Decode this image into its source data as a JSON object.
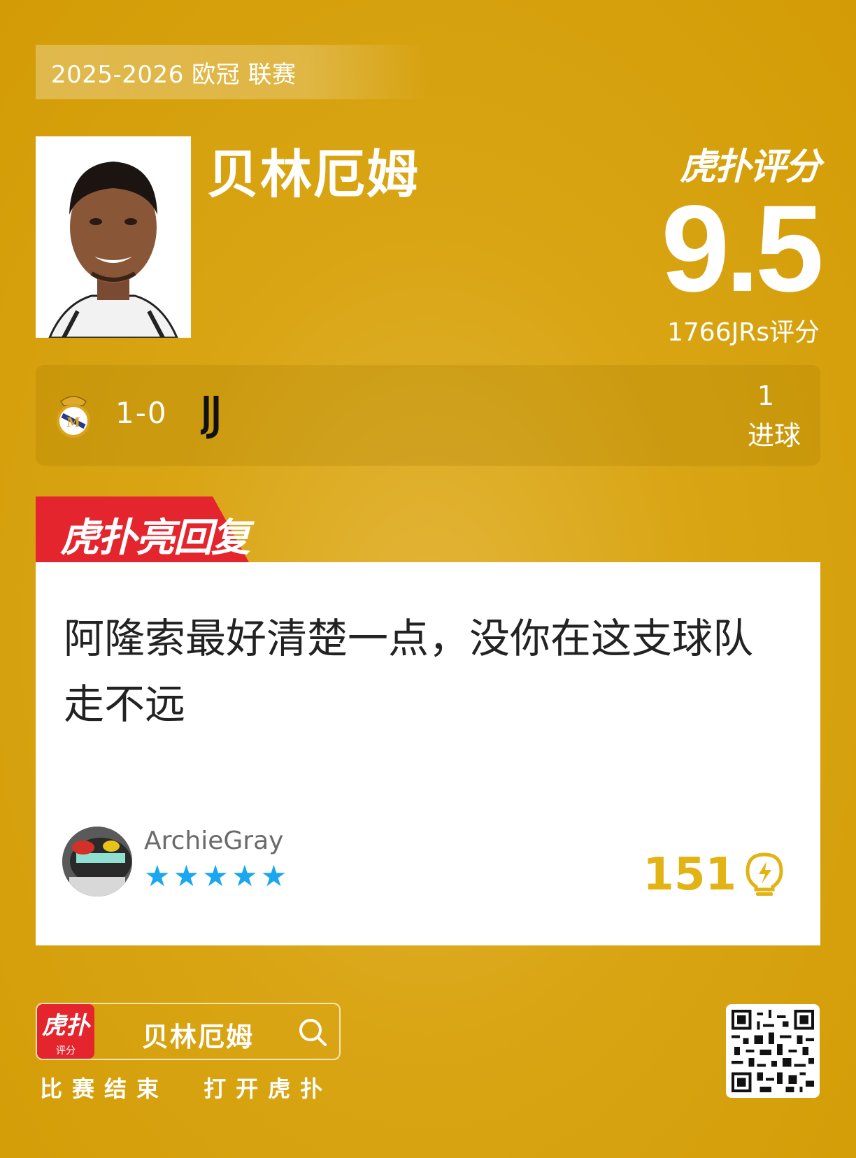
{
  "season_label": "2025-2026 欧冠 联赛",
  "player": {
    "name": "贝林厄姆"
  },
  "brand": "虎扑评分",
  "rating": {
    "score": "9.5",
    "votes_label": "1766JRs评分"
  },
  "match": {
    "score": "1-0",
    "home_crest_icon": "real-madrid-crest-icon",
    "away_crest_icon": "juventus-crest-icon",
    "goals_value": "1",
    "goals_label": "进球"
  },
  "reply_badge": "虎扑亮回复",
  "comment": {
    "text": "阿隆索最好清楚一点，没你在这支球队走不远",
    "username": "ArchieGray",
    "stars": "★★★★★",
    "likes": "151",
    "like_icon": "lightbulb-icon"
  },
  "footer": {
    "app_icon_label": "虎扑",
    "app_icon_sub": "评分",
    "search_text": "贝林厄姆",
    "cta_text": "比赛结束  打开虎扑"
  },
  "colors": {
    "background": "#d9a514",
    "accent_red": "#e4252e",
    "like_gold": "#e1b313",
    "star_blue": "#1aa7f0"
  }
}
